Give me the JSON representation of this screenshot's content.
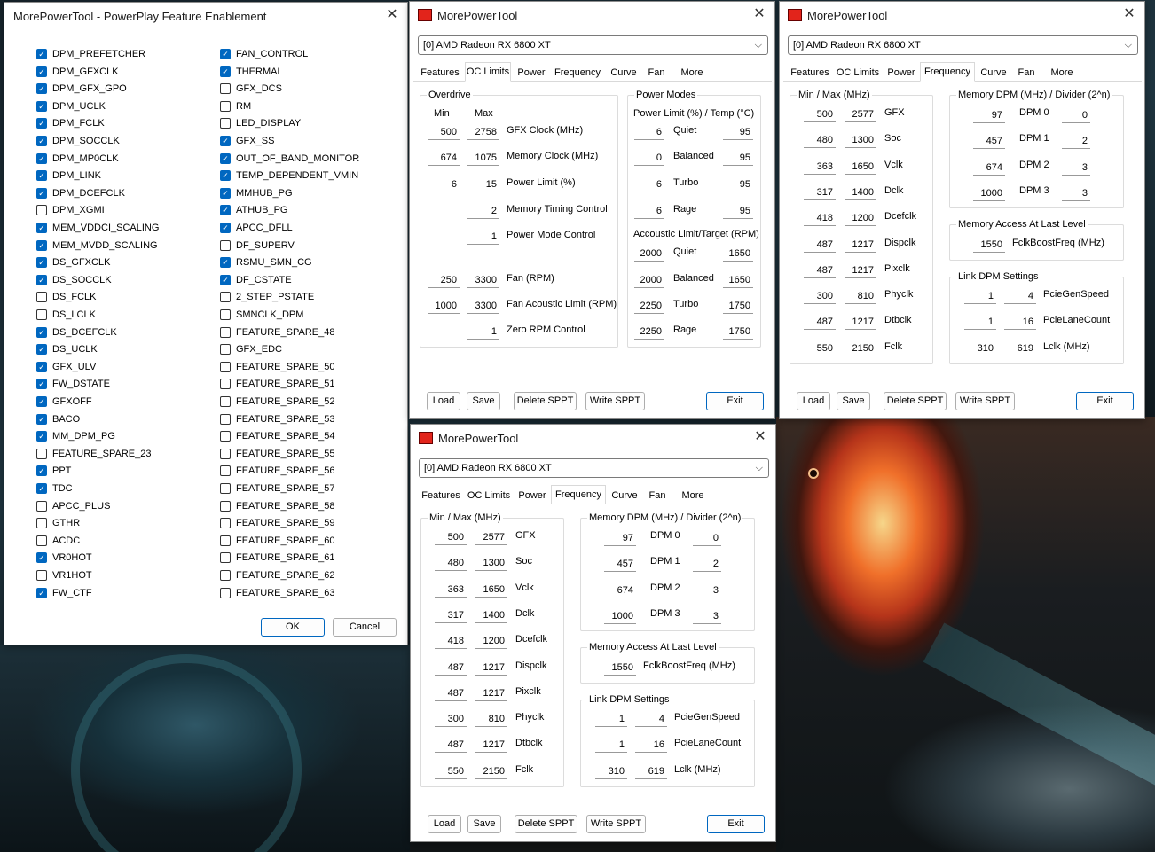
{
  "feature_window": {
    "title": "MorePowerTool - PowerPlay Feature Enablement",
    "col1": [
      {
        "label": "DPM_PREFETCHER",
        "checked": true
      },
      {
        "label": "DPM_GFXCLK",
        "checked": true
      },
      {
        "label": "DPM_GFX_GPO",
        "checked": true
      },
      {
        "label": "DPM_UCLK",
        "checked": true
      },
      {
        "label": "DPM_FCLK",
        "checked": true
      },
      {
        "label": "DPM_SOCCLK",
        "checked": true
      },
      {
        "label": "DPM_MP0CLK",
        "checked": true
      },
      {
        "label": "DPM_LINK",
        "checked": true
      },
      {
        "label": "DPM_DCEFCLK",
        "checked": true
      },
      {
        "label": "DPM_XGMI",
        "checked": false
      },
      {
        "label": "MEM_VDDCI_SCALING",
        "checked": true
      },
      {
        "label": "MEM_MVDD_SCALING",
        "checked": true
      },
      {
        "label": "DS_GFXCLK",
        "checked": true
      },
      {
        "label": "DS_SOCCLK",
        "checked": true
      },
      {
        "label": "DS_FCLK",
        "checked": false
      },
      {
        "label": "DS_LCLK",
        "checked": false
      },
      {
        "label": "DS_DCEFCLK",
        "checked": true
      },
      {
        "label": "DS_UCLK",
        "checked": true
      },
      {
        "label": "GFX_ULV",
        "checked": true
      },
      {
        "label": "FW_DSTATE",
        "checked": true
      },
      {
        "label": "GFXOFF",
        "checked": true
      },
      {
        "label": "BACO",
        "checked": true
      },
      {
        "label": "MM_DPM_PG",
        "checked": true
      },
      {
        "label": "FEATURE_SPARE_23",
        "checked": false
      },
      {
        "label": "PPT",
        "checked": true
      },
      {
        "label": "TDC",
        "checked": true
      },
      {
        "label": "APCC_PLUS",
        "checked": false
      },
      {
        "label": "GTHR",
        "checked": false
      },
      {
        "label": "ACDC",
        "checked": false
      },
      {
        "label": "VR0HOT",
        "checked": true
      },
      {
        "label": "VR1HOT",
        "checked": false
      },
      {
        "label": "FW_CTF",
        "checked": true
      }
    ],
    "col2": [
      {
        "label": "FAN_CONTROL",
        "checked": true
      },
      {
        "label": "THERMAL",
        "checked": true
      },
      {
        "label": "GFX_DCS",
        "checked": false
      },
      {
        "label": "RM",
        "checked": false
      },
      {
        "label": "LED_DISPLAY",
        "checked": false
      },
      {
        "label": "GFX_SS",
        "checked": true
      },
      {
        "label": "OUT_OF_BAND_MONITOR",
        "checked": true
      },
      {
        "label": "TEMP_DEPENDENT_VMIN",
        "checked": true
      },
      {
        "label": "MMHUB_PG",
        "checked": true
      },
      {
        "label": "ATHUB_PG",
        "checked": true
      },
      {
        "label": "APCC_DFLL",
        "checked": true
      },
      {
        "label": "DF_SUPERV",
        "checked": false
      },
      {
        "label": "RSMU_SMN_CG",
        "checked": true
      },
      {
        "label": "DF_CSTATE",
        "checked": true
      },
      {
        "label": "2_STEP_PSTATE",
        "checked": false
      },
      {
        "label": "SMNCLK_DPM",
        "checked": false
      },
      {
        "label": "FEATURE_SPARE_48",
        "checked": false
      },
      {
        "label": "GFX_EDC",
        "checked": false
      },
      {
        "label": "FEATURE_SPARE_50",
        "checked": false
      },
      {
        "label": "FEATURE_SPARE_51",
        "checked": false
      },
      {
        "label": "FEATURE_SPARE_52",
        "checked": false
      },
      {
        "label": "FEATURE_SPARE_53",
        "checked": false
      },
      {
        "label": "FEATURE_SPARE_54",
        "checked": false
      },
      {
        "label": "FEATURE_SPARE_55",
        "checked": false
      },
      {
        "label": "FEATURE_SPARE_56",
        "checked": false
      },
      {
        "label": "FEATURE_SPARE_57",
        "checked": false
      },
      {
        "label": "FEATURE_SPARE_58",
        "checked": false
      },
      {
        "label": "FEATURE_SPARE_59",
        "checked": false
      },
      {
        "label": "FEATURE_SPARE_60",
        "checked": false
      },
      {
        "label": "FEATURE_SPARE_61",
        "checked": false
      },
      {
        "label": "FEATURE_SPARE_62",
        "checked": false
      },
      {
        "label": "FEATURE_SPARE_63",
        "checked": false
      }
    ],
    "ok": "OK",
    "cancel": "Cancel"
  },
  "common": {
    "app_title": "MorePowerTool",
    "gpu": "[0] AMD Radeon RX 6800 XT",
    "tabs": [
      "Features",
      "OC Limits",
      "Power",
      "Frequency",
      "Curve",
      "Fan",
      "More"
    ],
    "buttons": {
      "load": "Load",
      "save": "Save",
      "delete": "Delete SPPT",
      "write": "Write SPPT",
      "exit": "Exit"
    },
    "close_glyph": "✕",
    "chevron": "⌵"
  },
  "oc": {
    "overdrive_title": "Overdrive",
    "min": "Min",
    "max": "Max",
    "rows": [
      {
        "min": "500",
        "max": "2758",
        "label": "GFX Clock (MHz)"
      },
      {
        "min": "674",
        "max": "1075",
        "label": "Memory Clock (MHz)"
      },
      {
        "min": "6",
        "max": "15",
        "label": "Power Limit (%)"
      },
      {
        "min": "",
        "max": "2",
        "label": "Memory Timing Control"
      },
      {
        "min": "",
        "max": "1",
        "label": "Power Mode Control"
      },
      {
        "min": "250",
        "max": "3300",
        "label": "Fan (RPM)"
      },
      {
        "min": "1000",
        "max": "3300",
        "label": "Fan Acoustic Limit (RPM)"
      },
      {
        "min": "",
        "max": "1",
        "label": "Zero RPM Control"
      }
    ],
    "power_modes_title": "Power Modes",
    "pl_title": "Power Limit (%) / Temp (°C)",
    "pl": [
      {
        "a": "6",
        "label": "Quiet",
        "b": "95"
      },
      {
        "a": "0",
        "label": "Balanced",
        "b": "95"
      },
      {
        "a": "6",
        "label": "Turbo",
        "b": "95"
      },
      {
        "a": "6",
        "label": "Rage",
        "b": "95"
      }
    ],
    "ac_title": "Accoustic Limit/Target (RPM)",
    "ac": [
      {
        "a": "2000",
        "label": "Quiet",
        "b": "1650"
      },
      {
        "a": "2000",
        "label": "Balanced",
        "b": "1650"
      },
      {
        "a": "2250",
        "label": "Turbo",
        "b": "1750"
      },
      {
        "a": "2250",
        "label": "Rage",
        "b": "1750"
      }
    ]
  },
  "freq": {
    "minmax_title": "Min / Max (MHz)",
    "rows": [
      {
        "min": "500",
        "max": "2577",
        "label": "GFX"
      },
      {
        "min": "480",
        "max": "1300",
        "label": "Soc"
      },
      {
        "min": "363",
        "max": "1650",
        "label": "Vclk"
      },
      {
        "min": "317",
        "max": "1400",
        "label": "Dclk"
      },
      {
        "min": "418",
        "max": "1200",
        "label": "Dcefclk"
      },
      {
        "min": "487",
        "max": "1217",
        "label": "Dispclk"
      },
      {
        "min": "487",
        "max": "1217",
        "label": "Pixclk"
      },
      {
        "min": "300",
        "max": "810",
        "label": "Phyclk"
      },
      {
        "min": "487",
        "max": "1217",
        "label": "Dtbclk"
      },
      {
        "min": "550",
        "max": "2150",
        "label": "Fclk"
      }
    ],
    "mem_title": "Memory DPM (MHz) / Divider (2^n)",
    "mem": [
      {
        "a": "97",
        "label": "DPM 0",
        "b": "0"
      },
      {
        "a": "457",
        "label": "DPM 1",
        "b": "2"
      },
      {
        "a": "674",
        "label": "DPM 2",
        "b": "3"
      },
      {
        "a": "1000",
        "label": "DPM 3",
        "b": "3"
      }
    ],
    "mall_title": "Memory Access At Last Level",
    "mall": {
      "a": "1550",
      "label": "FclkBoostFreq (MHz)"
    },
    "link_title": "Link DPM Settings",
    "link": [
      {
        "a": "1",
        "b": "4",
        "label": "PcieGenSpeed"
      },
      {
        "a": "1",
        "b": "16",
        "label": "PcieLaneCount"
      },
      {
        "a": "310",
        "b": "619",
        "label": "Lclk (MHz)"
      }
    ]
  }
}
